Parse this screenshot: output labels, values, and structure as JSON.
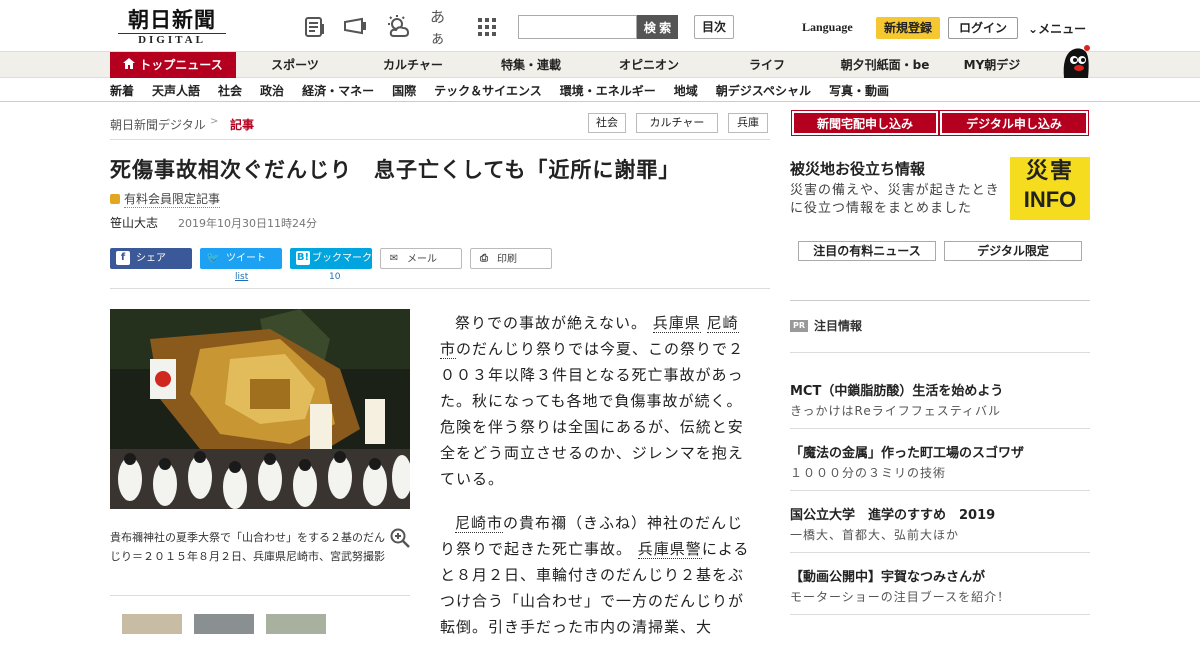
{
  "header": {
    "logo_jp": "朝日新聞",
    "logo_en": "DIGITAL",
    "font_toggle": "あぁ",
    "search_placeholder": "",
    "search_button": "検 索",
    "index_button": "目次",
    "language": "Language",
    "register": "新規登録",
    "login": "ログイン",
    "menu": "メニュー"
  },
  "categories": [
    "トップニュース",
    "スポーツ",
    "カルチャー",
    "特集・連載",
    "オピニオン",
    "ライフ",
    "朝夕刊紙面・be",
    "MY朝デジ"
  ],
  "subnav": [
    "新着",
    "天声人語",
    "社会",
    "政治",
    "経済・マネー",
    "国際",
    "テック＆サイエンス",
    "環境・エネルギー",
    "地域",
    "朝デジスペシャル",
    "写真・動画"
  ],
  "breadcrumb": {
    "home": "朝日新聞デジタル",
    "sep": ">",
    "current": "記事"
  },
  "tags": [
    "社会",
    "カルチャー",
    "兵庫"
  ],
  "article": {
    "title": "死傷事故相次ぐだんじり　息子亡くしても「近所に謝罪」",
    "paid_label": "有料会員限定記事",
    "author": "笹山大志",
    "date": "2019年10月30日11時24分",
    "share": {
      "facebook": "シェア",
      "twitter": "ツイート",
      "hatena": "ブックマーク",
      "mail": "メール",
      "print": "印刷",
      "twitter_count": "list",
      "hatena_count": "10"
    },
    "caption": "貴布禰神社の夏季大祭で「山合わせ」をする２基のだんじり＝２０１５年８月２日、兵庫県尼崎市、宮武努撮影",
    "p1_a": "祭りでの事故が絶えない。",
    "p1_link1": "兵庫県",
    "p1_link2": "尼崎市",
    "p1_b": "のだんじり祭りでは今夏、この祭りで２００３年以降３件目となる死亡事故があった。秋になっても各地で負傷事故が続く。危険を伴う祭りは全国にあるが、伝統と安全をどう両立させるのか、ジレンマを抱えている。",
    "p2_link1": "尼崎市",
    "p2_a": "の貴布禰（きふね）神社のだんじり祭りで起きた死亡事故。",
    "p2_link2": "兵庫県警",
    "p2_b": "によると８月２日、車輪付きのだんじり２基をぶつけ合う「山合わせ」で一方のだんじりが転倒。引き手だった市内の清掃業、大"
  },
  "side": {
    "btn_home": "新聞宅配申し込み",
    "btn_digital": "デジタル申し込み",
    "disaster_head": "被災地お役立ち情報",
    "disaster_text": "災害の備えや、災害が起きたときに役立つ情報をまとめました",
    "disaster_img_a": "災害",
    "disaster_img_b": "INFO",
    "btn_paid_news": "注目の有料ニュース",
    "btn_digital_only": "デジタル限定",
    "pr_badge": "PR",
    "pr_label": "注目情報",
    "ads": [
      {
        "h": "MCT（中鎖脂肪酸）生活を始めよう",
        "s": "きっかけはReライフフェスティバル"
      },
      {
        "h": "「魔法の金属」作った町工場のスゴワザ",
        "s": "１０００分の３ミリの技術"
      },
      {
        "h": "国公立大学　進学のすすめ　2019",
        "s": "一橋大、首都大、弘前大ほか"
      },
      {
        "h": "【動画公開中】宇賀なつみさんが",
        "s": "モーターショーの注目ブースを紹介！"
      }
    ]
  },
  "colors": {
    "brand_red": "#b4001e",
    "register_yellow": "#f5c832",
    "disaster_yellow": "#f6dc1e"
  }
}
